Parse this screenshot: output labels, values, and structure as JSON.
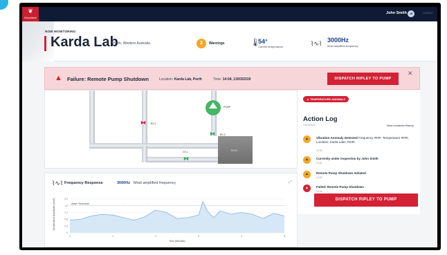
{
  "colors": {
    "brand_red": "#d32135",
    "navy": "#0f1b35",
    "warning": "#f5a623",
    "accent_blue": "#1a3f86",
    "pump_green": "#45b567",
    "alert_bg": "#f7d6da"
  },
  "topbar": {
    "logo_icon": "leaf-icon",
    "logo_text": "Woodside",
    "user_name": "John Smith",
    "avatar_initials": "JS",
    "logout_label": "LOGOUT"
  },
  "header": {
    "monitoring_label": "NOW MONITORING:",
    "lab_name": "Karda Lab",
    "lab_location": "Perth, Western Australia",
    "warnings_count": "2",
    "warnings_label": "Warnings",
    "thermometer_icon": "thermometer-icon",
    "temperature_value": "54°",
    "temperature_label": "Current temperature",
    "frequency_icon": "waveform-icon",
    "frequency_value": "3000Hz",
    "frequency_label": "Most amplified frequency"
  },
  "alert": {
    "icon": "warning-triangle-icon",
    "title": "Failure: Remote Pump Shutdown",
    "location_prefix": "Location:",
    "location_value": "Karda Lab, Perth",
    "time_prefix": "Time:",
    "time_value": "14:04, 13/03/2019",
    "dispatch_label": "DISPATCH RIPLEY TO PUMP",
    "close_icon": "close-icon"
  },
  "diagram": {
    "valve_1_label": "BV-1",
    "valve_2_label": "BV-2",
    "valve_3_label": "GV-1",
    "pump_label": "PUMP",
    "tank_label": "TANK"
  },
  "frequency_panel": {
    "title": "Frequency Response",
    "value": "3000Hz",
    "subtitle": "Most amplified frequency",
    "expand_icon": "expand-icon"
  },
  "chart_data": {
    "type": "area",
    "title": "",
    "xlabel": "Time (Minutes)",
    "ylabel": "Acceleration Amplitude (m/s2)",
    "threshold_label": "Alarm Threshold",
    "threshold": 1.6,
    "xlim": [
      0,
      5
    ],
    "ylim": [
      0,
      2.2
    ],
    "x_ticks": [
      "0",
      "1",
      "2",
      "3",
      "4",
      "5"
    ],
    "y_ticks": [
      "0",
      "0.4",
      "0.8",
      "1.2",
      "1.6",
      "2.0"
    ],
    "series": [
      {
        "x": [
          0,
          0.25,
          0.5,
          0.75,
          1.0,
          1.25,
          1.5,
          1.75,
          2.0,
          2.25,
          2.5,
          2.75,
          3.0,
          3.1,
          3.2,
          3.35,
          3.5,
          3.75,
          4.0,
          4.25,
          4.5,
          4.75,
          5.0
        ],
        "values": [
          0.75,
          0.8,
          1.0,
          1.1,
          1.05,
          0.9,
          0.75,
          0.95,
          1.35,
          1.2,
          0.85,
          0.9,
          1.05,
          1.85,
          1.3,
          0.9,
          1.3,
          1.1,
          1.2,
          1.1,
          0.85,
          1.15,
          1.0
        ]
      }
    ]
  },
  "action_log": {
    "anomaly_badge": "TEMPERATURE ANOMALY",
    "title": "Action Log",
    "date": "13/03/2019",
    "history_link": "View Incidents History",
    "events": [
      {
        "icon": "warning-icon",
        "title": "Vibration Anomaly Detected",
        "detail": "Frequency ####, Temperature ####, Location: Karda Labs, Perth",
        "time": "14:00"
      },
      {
        "icon": "warning-icon",
        "title": "Currently under inspection by John Smith",
        "detail": "",
        "time": "14:01"
      },
      {
        "icon": "warning-icon",
        "title": "Remote Pump Shutdown Initiated",
        "detail": "",
        "time": "14:02"
      },
      {
        "icon": "error-icon",
        "title": "Failed: Remote Pump Shutdown",
        "detail": "",
        "time": "14:04"
      }
    ],
    "dispatch_label": "DISPATCH RIPLEY TO PUMP"
  }
}
